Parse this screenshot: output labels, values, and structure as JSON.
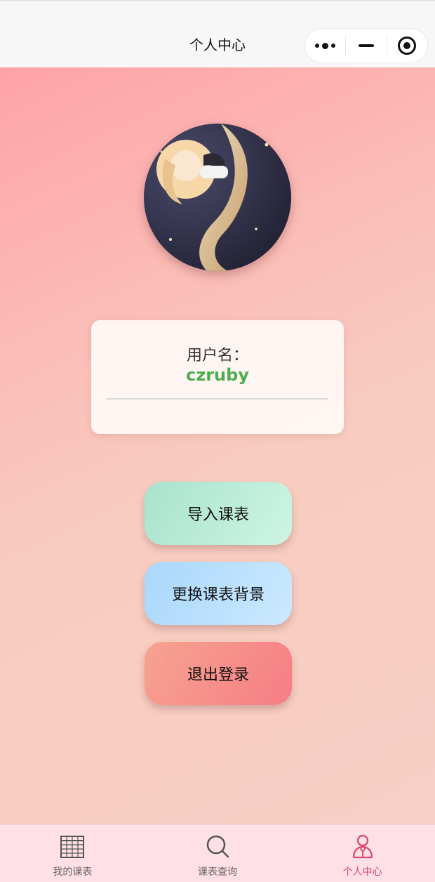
{
  "nav": {
    "title": "个人中心",
    "capsule": [
      "more-icon",
      "minimize-icon",
      "close-target-icon"
    ]
  },
  "profile": {
    "username_label": "用户名：",
    "username": "czruby"
  },
  "actions": {
    "import": "导入课表",
    "change_bg": "更换课表背景",
    "logout": "退出登录"
  },
  "tabs": [
    {
      "label": "我的课表",
      "icon": "calendar-icon",
      "active": false
    },
    {
      "label": "课表查询",
      "icon": "search-icon",
      "active": false
    },
    {
      "label": "个人中心",
      "icon": "user-icon",
      "active": true
    }
  ],
  "colors": {
    "active_tab": "#d9456a",
    "username": "#4cae4f",
    "tab_bar_bg": "#ffe0e6"
  }
}
